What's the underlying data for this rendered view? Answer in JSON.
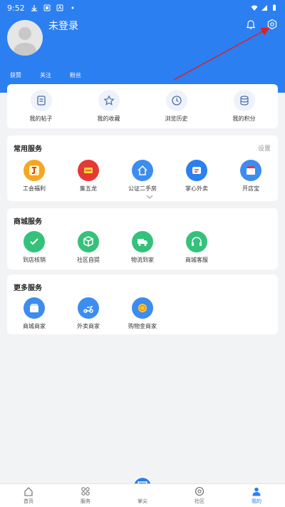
{
  "status_bar": {
    "time": "9:52"
  },
  "profile": {
    "username": "未登录"
  },
  "stats": [
    "获赞",
    "关注",
    "粉丝"
  ],
  "quick_actions": [
    {
      "label": "我的帖子",
      "icon": "document-icon"
    },
    {
      "label": "我的收藏",
      "icon": "star-icon"
    },
    {
      "label": "浏览历史",
      "icon": "clock-icon"
    },
    {
      "label": "我的积分",
      "icon": "database-icon"
    }
  ],
  "common_services": {
    "title": "常用服务",
    "settings_label": "设置",
    "items": [
      {
        "label": "工会福利",
        "icon": "union-benefit-icon",
        "color": "#f5a623"
      },
      {
        "label": "集五龙",
        "icon": "collect-dragon-icon",
        "color": "#e53935"
      },
      {
        "label": "公证二手房",
        "icon": "house-icon",
        "color": "#3d8cf0"
      },
      {
        "label": "掌心外卖",
        "icon": "takeout-icon",
        "color": "#2b7ff0"
      },
      {
        "label": "开店宝",
        "icon": "shop-icon",
        "color": "#3d8cf0"
      }
    ]
  },
  "mall_services": {
    "title": "商城服务",
    "items": [
      {
        "label": "到店核销",
        "icon": "verify-icon",
        "color": "#34c27a"
      },
      {
        "label": "社区自提",
        "icon": "pickup-icon",
        "color": "#34c27a"
      },
      {
        "label": "物流到家",
        "icon": "truck-icon",
        "color": "#34c27a"
      },
      {
        "label": "商城客服",
        "icon": "headset-icon",
        "color": "#34c27a"
      }
    ]
  },
  "more_services": {
    "title": "更多服务",
    "items": [
      {
        "label": "商城商家",
        "icon": "store-icon",
        "color": "#3d8cf0"
      },
      {
        "label": "外卖商家",
        "icon": "scooter-icon",
        "color": "#3d8cf0"
      },
      {
        "label": "购物金商家",
        "icon": "coin-icon",
        "color": "#3d8cf0"
      }
    ]
  },
  "bottom_nav": [
    {
      "label": "首页",
      "icon": "home-icon"
    },
    {
      "label": "服务",
      "icon": "grid-icon"
    },
    {
      "label": "掌尖",
      "icon": "app-logo-icon"
    },
    {
      "label": "社区",
      "icon": "community-icon"
    },
    {
      "label": "我的",
      "icon": "user-icon"
    }
  ],
  "colors": {
    "primary": "#2b7ff0",
    "background": "#f2f3f5",
    "annotation": "#e02020"
  }
}
